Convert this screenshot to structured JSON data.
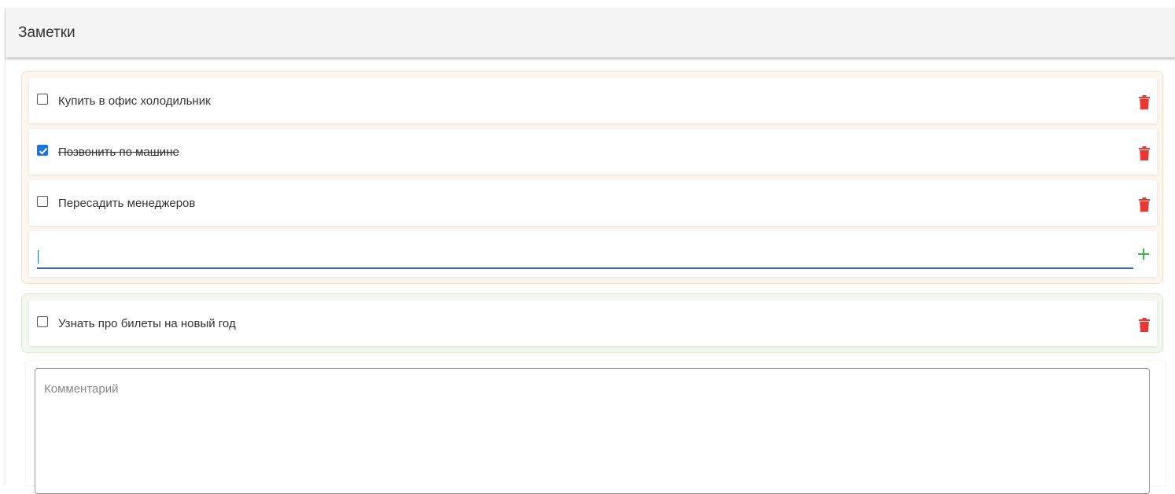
{
  "panel": {
    "title": "Заметки"
  },
  "groups": [
    {
      "color": "#f7ddcd",
      "tasks": [
        {
          "label": "Купить в офис холодильник",
          "done": false
        },
        {
          "label": "Позвонить по машине",
          "done": true
        },
        {
          "label": "Пересадить менеджеров",
          "done": false
        }
      ],
      "new_task": {
        "value": "",
        "add_icon": "plus-icon"
      }
    },
    {
      "color": "#d9e8cf",
      "tasks": [
        {
          "label": "Узнать про билеты на новый год",
          "done": false
        }
      ]
    }
  ],
  "comment": {
    "placeholder": "Комментарий",
    "value": ""
  },
  "colors": {
    "accent": "#1e73d6",
    "delete": "#e53935",
    "add": "#4caf50",
    "input_underline": "#2c6fa8"
  },
  "icons": {
    "delete": "trash-icon",
    "add": "plus-icon",
    "checked": "checkmark-icon"
  }
}
